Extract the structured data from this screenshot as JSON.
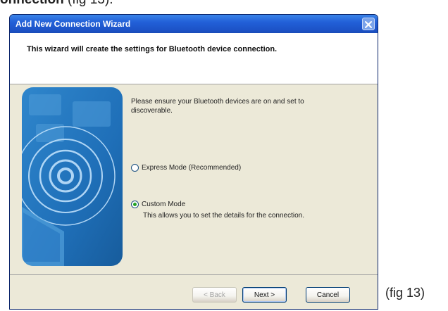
{
  "document": {
    "heading_bold": "onnection",
    "heading_rest": " (fig 13).",
    "caption": "(fig 13)"
  },
  "window": {
    "title": "Add New Connection Wizard",
    "header_text": "This wizard will create the settings for Bluetooth device connection."
  },
  "content": {
    "intro": "Please ensure your Bluetooth devices are on and set to discoverable.",
    "options": [
      {
        "label": "Express Mode (Recommended)",
        "checked": false
      },
      {
        "label": "Custom Mode",
        "checked": true
      }
    ],
    "custom_description": "This allows you to set the details for the connection."
  },
  "buttons": {
    "back": "< Back",
    "next": "Next >",
    "cancel": "Cancel"
  },
  "colors": {
    "titlebar": "#2260d8",
    "illustration_blue": "#1f6fb8",
    "window_bg": "#ece9d8"
  }
}
